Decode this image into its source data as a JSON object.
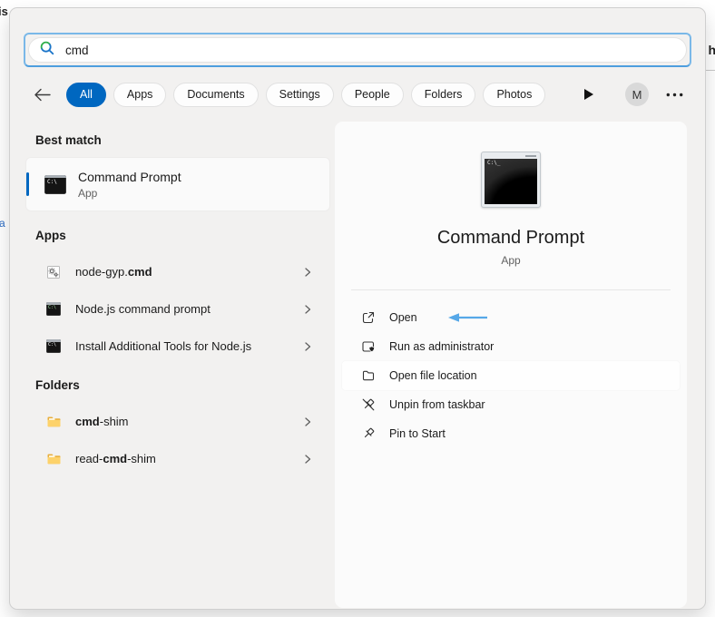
{
  "background": {
    "fragments": {
      "top_left": "is",
      "left": "a",
      "top_right": "h"
    }
  },
  "search": {
    "value": "cmd",
    "icon": "search-magnifier"
  },
  "filter_bar": {
    "back_icon": "back-arrow",
    "tabs": [
      {
        "label": "All",
        "active": true
      },
      {
        "label": "Apps",
        "active": false
      },
      {
        "label": "Documents",
        "active": false
      },
      {
        "label": "Settings",
        "active": false
      },
      {
        "label": "People",
        "active": false
      },
      {
        "label": "Folders",
        "active": false
      },
      {
        "label": "Photos",
        "active": false
      }
    ],
    "expand_icon": "play-triangle",
    "avatar_initial": "M",
    "more_icon": "ellipsis"
  },
  "left_column": {
    "best_match": {
      "header": "Best match",
      "title": "Command Prompt",
      "subtitle": "App",
      "icon": "command-prompt-terminal"
    },
    "apps": {
      "header": "Apps",
      "items": [
        {
          "icon": "batch-file-gears",
          "parts": [
            {
              "text": "node-gyp.",
              "bold": false
            },
            {
              "text": "cmd",
              "bold": true
            }
          ]
        },
        {
          "icon": "nodejs-terminal",
          "parts": [
            {
              "text": "Node.js command prompt",
              "bold": false
            }
          ]
        },
        {
          "icon": "cmd-terminal",
          "parts": [
            {
              "text": "Install Additional Tools for Node.js",
              "bold": false
            }
          ]
        }
      ]
    },
    "folders": {
      "header": "Folders",
      "items": [
        {
          "icon": "folder-yellow",
          "parts": [
            {
              "text": "cmd",
              "bold": true
            },
            {
              "text": "-shim",
              "bold": false
            }
          ]
        },
        {
          "icon": "folder-yellow",
          "parts": [
            {
              "text": "read-",
              "bold": false
            },
            {
              "text": "cmd",
              "bold": true
            },
            {
              "text": "-shim",
              "bold": false
            }
          ]
        }
      ]
    }
  },
  "preview": {
    "icon": "command-prompt-terminal-large",
    "title": "Command Prompt",
    "subtitle": "App",
    "actions": [
      {
        "icon": "open-external",
        "label": "Open",
        "annotated": true
      },
      {
        "icon": "admin-shield",
        "label": "Run as administrator",
        "annotated": false
      },
      {
        "icon": "folder-outline",
        "label": "Open file location",
        "highlighted": true
      },
      {
        "icon": "unpin",
        "label": "Unpin from taskbar",
        "annotated": false
      },
      {
        "icon": "pin",
        "label": "Pin to Start",
        "annotated": false
      }
    ]
  },
  "icons": {
    "cmd_glyph": "C:\\",
    "cmd_glyph_large": "C:\\_"
  },
  "colors": {
    "accent_blue": "#0067c0",
    "focus_ring_blue": "#7ab8e8",
    "annotation_arrow_blue": "#56a8e8",
    "folder_yellow": "#fdd26a",
    "panel_background": "#f2f1f0",
    "card_background": "#fbfbfb"
  }
}
